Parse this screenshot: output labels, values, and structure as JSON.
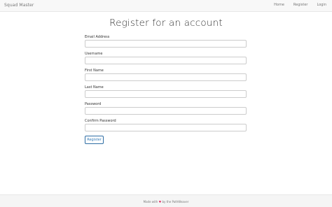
{
  "navbar": {
    "brand": "Squad Master",
    "links": [
      "Home",
      "Register",
      "Login"
    ]
  },
  "page": {
    "title": "Register for an account"
  },
  "form": {
    "fields": [
      {
        "label": "Email Address",
        "value": "",
        "placeholder": ""
      },
      {
        "label": "Username",
        "value": "",
        "placeholder": ""
      },
      {
        "label": "First Name",
        "value": "",
        "placeholder": ""
      },
      {
        "label": "Last Name",
        "value": "",
        "placeholder": ""
      },
      {
        "label": "Password",
        "value": "",
        "placeholder": ""
      },
      {
        "label": "Confirm Password",
        "value": "",
        "placeholder": ""
      }
    ],
    "submit_label": "Register"
  },
  "footer": {
    "text_before": "Made with",
    "heart": "♥",
    "text_after": "by the PathWeaver"
  },
  "colors": {
    "navbar_bg": "#f8f8f8",
    "button_text": "#337ab7",
    "heart": "#e0245e"
  }
}
